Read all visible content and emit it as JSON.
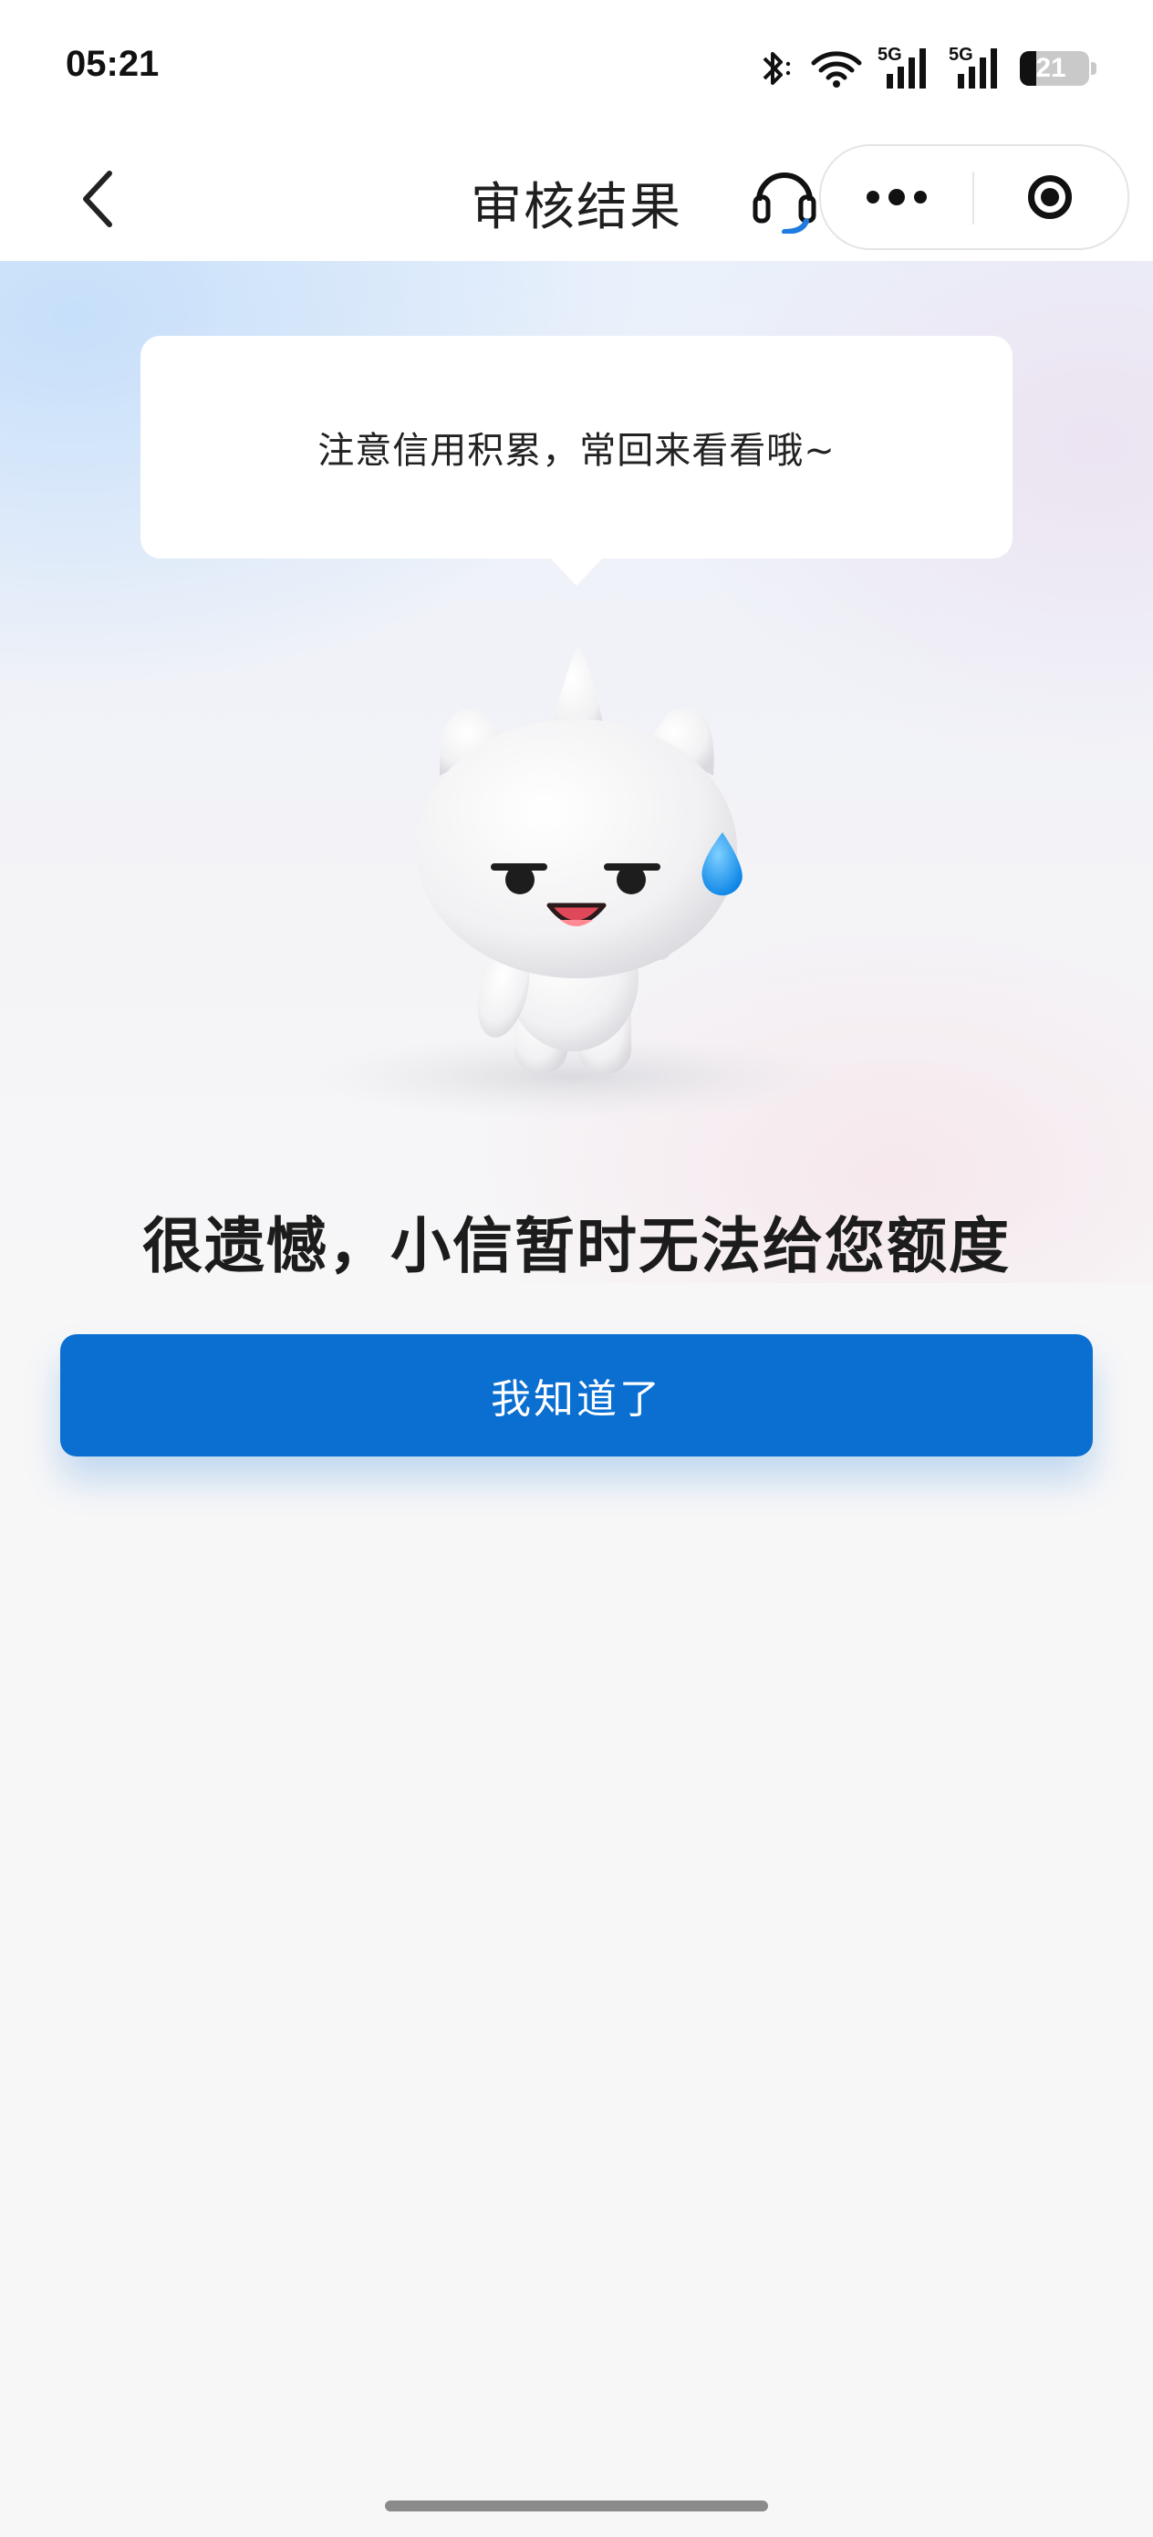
{
  "status_bar": {
    "time": "05:21",
    "signal_1_label": "5G",
    "signal_2_label": "5G",
    "battery_level": "21",
    "icons": [
      "bluetooth-icon",
      "wifi-icon",
      "signal-5g-icon",
      "signal-5g-icon",
      "battery-icon"
    ]
  },
  "nav": {
    "title": "审核结果",
    "icons": [
      "back-arrow-icon",
      "headset-icon",
      "more-dots-icon",
      "miniapp-close-icon"
    ]
  },
  "bubble": {
    "text": "注意信用积累，常回来看看哦~"
  },
  "mascot": {
    "icon": "mascot-cat-illustration"
  },
  "result": {
    "title": "很遗憾，小信暂时无法给您额度",
    "button_label": "我知道了"
  },
  "colors": {
    "primary": "#0A6FD1",
    "background": "#F7F7F8",
    "headset_accent": "#1E7BE0"
  }
}
